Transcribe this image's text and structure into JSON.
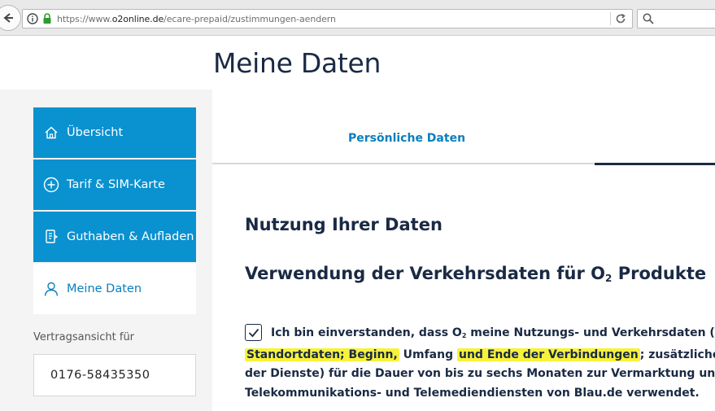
{
  "browser": {
    "url_prefix": "https://www.",
    "url_domain": "o2online.de",
    "url_path": "/ecare-prepaid/zustimmungen-aendern",
    "search_placeholder": "Q"
  },
  "page": {
    "title": "Meine Daten"
  },
  "sidebar": {
    "items": [
      {
        "label": "Übersicht",
        "icon": "home-icon"
      },
      {
        "label": "Tarif & SIM-Karte",
        "icon": "plus-circle-icon"
      },
      {
        "label": "Guthaben & Aufladen",
        "icon": "credit-icon"
      },
      {
        "label": "Meine Daten",
        "icon": "user-icon"
      }
    ],
    "contract_label": "Vertragsansicht für",
    "contract_number": "0176-58435350"
  },
  "tabs": {
    "personal": "Persönliche Daten"
  },
  "content": {
    "section_title": "Nutzung Ihrer Daten",
    "subsection_title_pre": "Verwendung der Verkehrsdaten für O",
    "subsection_title_sub": "2",
    "subsection_title_post": " Produkte",
    "consent": {
      "checked": true,
      "l1_a": "Ich bin einverstanden, dass O",
      "l1_sub": "2",
      "l1_b": " meine Nutzungs- und Verkehrsdaten (Teiln",
      "l2_hl1": "Standortdaten; Beginn,",
      "l2_mid": " Umfang ",
      "l2_hl2": "und Ende der Verbindungen",
      "l2_end": "; zusätzliche Info",
      "l3": "der Dienste) für die Dauer von bis zu sechs Monaten zur Vermarktung und be",
      "l4": "Telekommunikations- und Telemediendiensten von Blau.de verwendet."
    }
  },
  "colors": {
    "nav_blue": "#0a91d0",
    "link_blue": "#0a7fbd",
    "text_dark": "#1a2a44",
    "highlight": "#f7f23a"
  }
}
